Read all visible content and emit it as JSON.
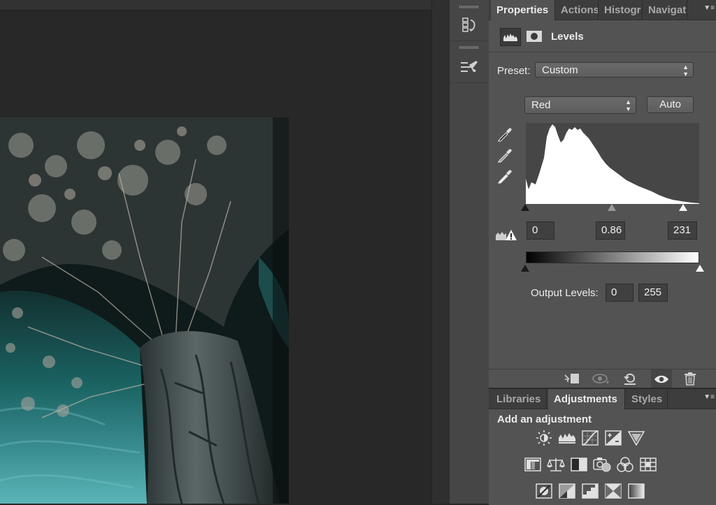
{
  "properties_panel": {
    "tabs": [
      {
        "label": "Properties"
      },
      {
        "label": "Actions"
      },
      {
        "label": "Histogr"
      },
      {
        "label": "Navigat"
      }
    ],
    "menu_icon": "panel-menu-icon",
    "adjustment_title": "Levels",
    "preset_label": "Preset:",
    "preset_value": "Custom",
    "channel_value": "Red",
    "auto_label": "Auto",
    "input_black": "0",
    "input_gamma": "0.86",
    "input_white": "231",
    "output_label": "Output Levels:",
    "output_black": "0",
    "output_white": "255",
    "bottom_icons": [
      "clip-to-layer-icon",
      "view-previous-state-icon",
      "reset-icon",
      "visibility-eye-icon",
      "trash-icon"
    ]
  },
  "adjustments_panel": {
    "tabs": [
      {
        "label": "Libraries"
      },
      {
        "label": "Adjustments"
      },
      {
        "label": "Styles"
      }
    ],
    "heading": "Add an adjustment",
    "row1": [
      "brightness-contrast-icon",
      "levels-icon",
      "curves-icon",
      "exposure-icon",
      "vibrance-icon"
    ],
    "row2": [
      "hue-saturation-icon",
      "color-balance-icon",
      "black-white-icon",
      "photo-filter-icon",
      "channel-mixer-icon",
      "color-lookup-icon"
    ],
    "row3": [
      "invert-icon",
      "posterize-icon",
      "threshold-icon",
      "selective-color-icon",
      "gradient-map-icon"
    ]
  },
  "colors": {
    "panel_bg": "#535353",
    "tab_bar_bg": "#3d3d3d",
    "canvas_bg": "#282828",
    "histogram_fill": "#ffffff",
    "photo_sky": "#1b5f5f"
  }
}
